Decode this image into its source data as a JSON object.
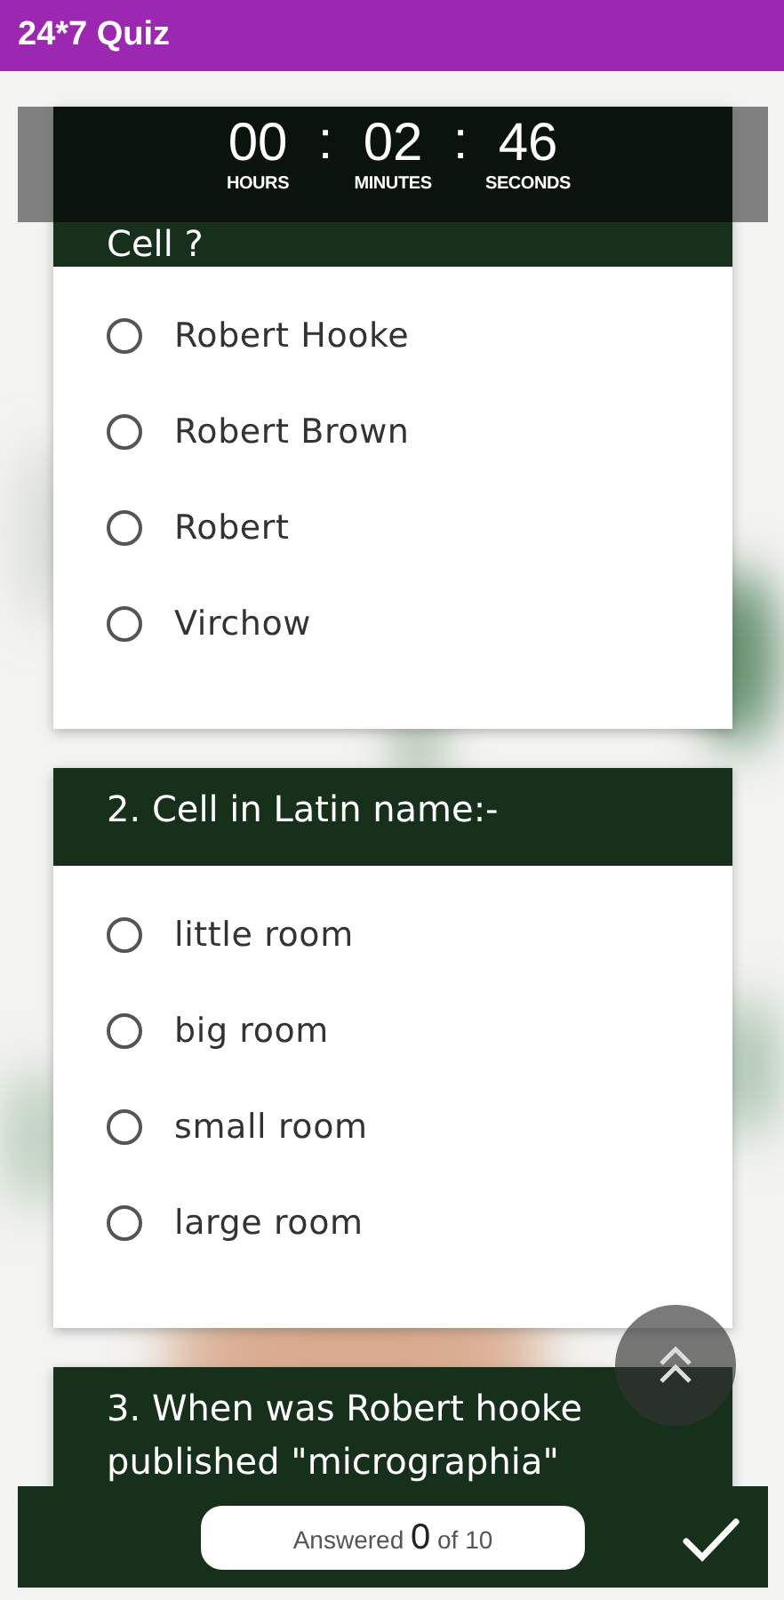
{
  "app_bar": {
    "title": "24*7 Quiz"
  },
  "timer": {
    "units": [
      {
        "value": "00",
        "label": "HOURS"
      },
      {
        "value": "02",
        "label": "MINUTES"
      },
      {
        "value": "46",
        "label": "SECONDS"
      }
    ],
    "separators": [
      ":",
      ":"
    ]
  },
  "questions": [
    {
      "text": "Cell ?",
      "options": [
        {
          "label": "Robert Hooke",
          "selected": false
        },
        {
          "label": "Robert Brown",
          "selected": false
        },
        {
          "label": "Robert",
          "selected": false
        },
        {
          "label": "Virchow",
          "selected": false
        }
      ]
    },
    {
      "text": "2. Cell in Latin name:-",
      "options": [
        {
          "label": "little room",
          "selected": false
        },
        {
          "label": "big room",
          "selected": false
        },
        {
          "label": "small room",
          "selected": false
        },
        {
          "label": "large room",
          "selected": false
        }
      ]
    },
    {
      "text": "3. When was Robert hooke published \"micrographia\""
    }
  ],
  "footer": {
    "answered": "Answered **0** of 10"
  }
}
